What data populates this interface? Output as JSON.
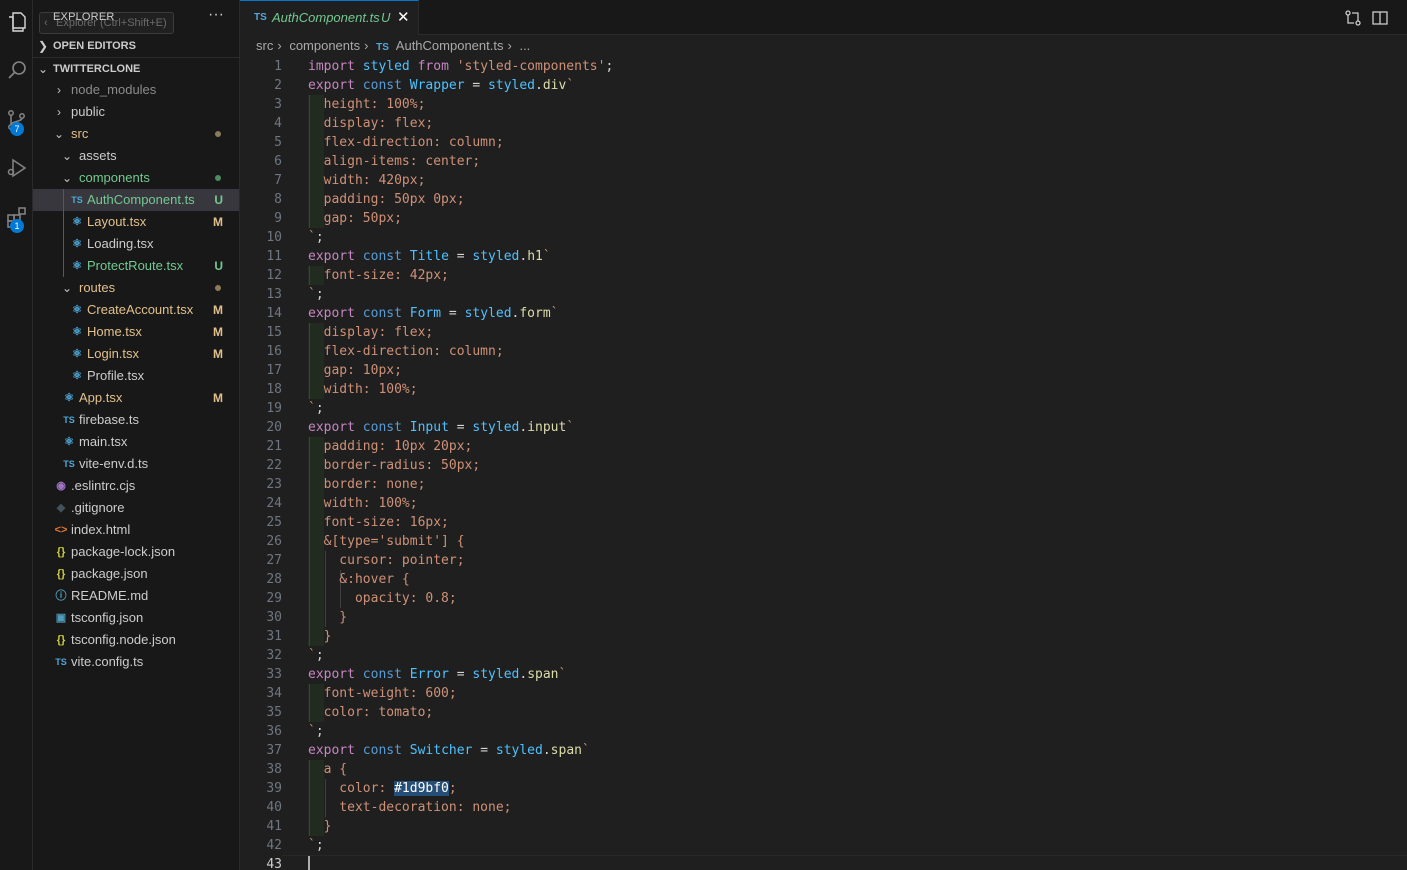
{
  "explorer": {
    "title": "EXPLORER",
    "tooltip": "Explorer (Ctrl+Shift+E)",
    "more": "···",
    "open_editors": "OPEN EDITORS",
    "project": "TWITTERCLONE"
  },
  "activity": {
    "scm_badge": "7",
    "ext_badge": "1"
  },
  "tree": [
    {
      "name": "node_modules",
      "depth": 1,
      "folder": true,
      "open": false,
      "color": "#8b8b8b"
    },
    {
      "name": "public",
      "depth": 1,
      "folder": true,
      "open": false,
      "color": "#cccccc"
    },
    {
      "name": "src",
      "depth": 1,
      "folder": true,
      "open": true,
      "color": "#e2c08d",
      "dot": "#8c7a5c"
    },
    {
      "name": "assets",
      "depth": 2,
      "folder": true,
      "open": true,
      "color": "#cccccc"
    },
    {
      "name": "components",
      "depth": 2,
      "folder": true,
      "open": true,
      "color": "#73c991",
      "dot": "#4e8b63"
    },
    {
      "name": "AuthComponent.ts",
      "depth": 3,
      "icon": "TS",
      "iconColor": "#4fa8d8",
      "color": "#73c991",
      "status": "U",
      "statusColor": "#73c991",
      "selected": true
    },
    {
      "name": "Layout.tsx",
      "depth": 3,
      "icon": "react",
      "iconColor": "#4fa8d8",
      "color": "#e2c08d",
      "status": "M",
      "statusColor": "#e2c08d"
    },
    {
      "name": "Loading.tsx",
      "depth": 3,
      "icon": "react",
      "iconColor": "#4fa8d8",
      "color": "#cccccc"
    },
    {
      "name": "ProtectRoute.tsx",
      "depth": 3,
      "icon": "react",
      "iconColor": "#4fa8d8",
      "color": "#73c991",
      "status": "U",
      "statusColor": "#73c991"
    },
    {
      "name": "routes",
      "depth": 2,
      "folder": true,
      "open": true,
      "color": "#e2c08d",
      "dot": "#8c7a5c"
    },
    {
      "name": "CreateAccount.tsx",
      "depth": 3,
      "icon": "react",
      "iconColor": "#4fa8d8",
      "color": "#e2c08d",
      "status": "M",
      "statusColor": "#e2c08d"
    },
    {
      "name": "Home.tsx",
      "depth": 3,
      "icon": "react",
      "iconColor": "#4fa8d8",
      "color": "#e2c08d",
      "status": "M",
      "statusColor": "#e2c08d"
    },
    {
      "name": "Login.tsx",
      "depth": 3,
      "icon": "react",
      "iconColor": "#4fa8d8",
      "color": "#e2c08d",
      "status": "M",
      "statusColor": "#e2c08d"
    },
    {
      "name": "Profile.tsx",
      "depth": 3,
      "icon": "react",
      "iconColor": "#4fa8d8",
      "color": "#cccccc"
    },
    {
      "name": "App.tsx",
      "depth": 2,
      "icon": "react",
      "iconColor": "#4fa8d8",
      "color": "#e2c08d",
      "status": "M",
      "statusColor": "#e2c08d"
    },
    {
      "name": "firebase.ts",
      "depth": 2,
      "icon": "TS",
      "iconColor": "#4fa8d8",
      "color": "#cccccc"
    },
    {
      "name": "main.tsx",
      "depth": 2,
      "icon": "react",
      "iconColor": "#4fa8d8",
      "color": "#cccccc"
    },
    {
      "name": "vite-env.d.ts",
      "depth": 2,
      "icon": "TS",
      "iconColor": "#4fa8d8",
      "color": "#cccccc"
    },
    {
      "name": ".eslintrc.cjs",
      "depth": 1,
      "icon": "eslint",
      "iconColor": "#a074c4",
      "color": "#cccccc"
    },
    {
      "name": ".gitignore",
      "depth": 1,
      "icon": "git",
      "iconColor": "#41535b",
      "color": "#cccccc"
    },
    {
      "name": "index.html",
      "depth": 1,
      "icon": "html",
      "iconColor": "#e37933",
      "color": "#cccccc"
    },
    {
      "name": "package-lock.json",
      "depth": 1,
      "icon": "json",
      "iconColor": "#cbcb41",
      "color": "#cccccc"
    },
    {
      "name": "package.json",
      "depth": 1,
      "icon": "json",
      "iconColor": "#cbcb41",
      "color": "#cccccc"
    },
    {
      "name": "README.md",
      "depth": 1,
      "icon": "info",
      "iconColor": "#519aba",
      "color": "#cccccc"
    },
    {
      "name": "tsconfig.json",
      "depth": 1,
      "icon": "tsconfig",
      "iconColor": "#519aba",
      "color": "#cccccc"
    },
    {
      "name": "tsconfig.node.json",
      "depth": 1,
      "icon": "json",
      "iconColor": "#cbcb41",
      "color": "#cccccc"
    },
    {
      "name": "vite.config.ts",
      "depth": 1,
      "icon": "TS",
      "iconColor": "#4fa8d8",
      "color": "#cccccc"
    }
  ],
  "tab": {
    "icon": "TS",
    "name": "AuthComponent.ts",
    "status": "U",
    "close": "✕"
  },
  "breadcrumb": [
    "src",
    "components",
    "AuthComponent.ts",
    "..."
  ],
  "current_line": 43,
  "code": [
    [
      [
        "ki",
        "import"
      ],
      [
        "v",
        " styled"
      ],
      [
        "ki",
        " from"
      ],
      [
        "s",
        " 'styled-components'"
      ],
      [
        "p",
        ";"
      ]
    ],
    [
      [
        "ki",
        "export"
      ],
      [
        "k",
        " const"
      ],
      [
        "v",
        " Wrapper"
      ],
      [
        "p",
        " = "
      ],
      [
        "v",
        "styled"
      ],
      [
        "p",
        "."
      ],
      [
        "m",
        "div"
      ],
      [
        "s",
        "`"
      ]
    ],
    [
      [
        "s",
        "  height: 100%;"
      ]
    ],
    [
      [
        "s",
        "  display: flex;"
      ]
    ],
    [
      [
        "s",
        "  flex-direction: column;"
      ]
    ],
    [
      [
        "s",
        "  align-items: center;"
      ]
    ],
    [
      [
        "s",
        "  width: 420px;"
      ]
    ],
    [
      [
        "s",
        "  padding: 50px 0px;"
      ]
    ],
    [
      [
        "s",
        "  gap: 50px;"
      ]
    ],
    [
      [
        "s",
        "`"
      ],
      [
        "p",
        ";"
      ]
    ],
    [
      [
        "ki",
        "export"
      ],
      [
        "k",
        " const"
      ],
      [
        "v",
        " Title"
      ],
      [
        "p",
        " = "
      ],
      [
        "v",
        "styled"
      ],
      [
        "p",
        "."
      ],
      [
        "m",
        "h1"
      ],
      [
        "s",
        "`"
      ]
    ],
    [
      [
        "s",
        "  font-size: 42px;"
      ]
    ],
    [
      [
        "s",
        "`"
      ],
      [
        "p",
        ";"
      ]
    ],
    [
      [
        "ki",
        "export"
      ],
      [
        "k",
        " const"
      ],
      [
        "v",
        " Form"
      ],
      [
        "p",
        " = "
      ],
      [
        "v",
        "styled"
      ],
      [
        "p",
        "."
      ],
      [
        "m",
        "form"
      ],
      [
        "s",
        "`"
      ]
    ],
    [
      [
        "s",
        "  display: flex;"
      ]
    ],
    [
      [
        "s",
        "  flex-direction: column;"
      ]
    ],
    [
      [
        "s",
        "  gap: 10px;"
      ]
    ],
    [
      [
        "s",
        "  width: 100%;"
      ]
    ],
    [
      [
        "s",
        "`"
      ],
      [
        "p",
        ";"
      ]
    ],
    [
      [
        "ki",
        "export"
      ],
      [
        "k",
        " const"
      ],
      [
        "v",
        " Input"
      ],
      [
        "p",
        " = "
      ],
      [
        "v",
        "styled"
      ],
      [
        "p",
        "."
      ],
      [
        "m",
        "input"
      ],
      [
        "s",
        "`"
      ]
    ],
    [
      [
        "s",
        "  padding: 10px 20px;"
      ]
    ],
    [
      [
        "s",
        "  border-radius: 50px;"
      ]
    ],
    [
      [
        "s",
        "  border: none;"
      ]
    ],
    [
      [
        "s",
        "  width: 100%;"
      ]
    ],
    [
      [
        "s",
        "  font-size: 16px;"
      ]
    ],
    [
      [
        "s",
        "  &[type='submit'] {"
      ]
    ],
    [
      [
        "s",
        "    cursor: pointer;"
      ]
    ],
    [
      [
        "s",
        "    &:hover {"
      ]
    ],
    [
      [
        "s",
        "      opacity: 0.8;"
      ]
    ],
    [
      [
        "s",
        "    }"
      ]
    ],
    [
      [
        "s",
        "  }"
      ]
    ],
    [
      [
        "s",
        "`"
      ],
      [
        "p",
        ";"
      ]
    ],
    [
      [
        "ki",
        "export"
      ],
      [
        "k",
        " const"
      ],
      [
        "v",
        " Error"
      ],
      [
        "p",
        " = "
      ],
      [
        "v",
        "styled"
      ],
      [
        "p",
        "."
      ],
      [
        "m",
        "span"
      ],
      [
        "s",
        "`"
      ]
    ],
    [
      [
        "s",
        "  font-weight: 600;"
      ]
    ],
    [
      [
        "s",
        "  color: tomato;"
      ]
    ],
    [
      [
        "s",
        "`"
      ],
      [
        "p",
        ";"
      ]
    ],
    [
      [
        "ki",
        "export"
      ],
      [
        "k",
        " const"
      ],
      [
        "v",
        " Switcher"
      ],
      [
        "p",
        " = "
      ],
      [
        "v",
        "styled"
      ],
      [
        "p",
        "."
      ],
      [
        "m",
        "span"
      ],
      [
        "s",
        "`"
      ]
    ],
    [
      [
        "s",
        "  a {"
      ]
    ],
    [
      [
        "s",
        "    color: "
      ],
      [
        "hl",
        "#1d9bf0"
      ],
      [
        "s",
        ";"
      ]
    ],
    [
      [
        "s",
        "    text-decoration: none;"
      ]
    ],
    [
      [
        "s",
        "  }"
      ]
    ],
    [
      [
        "s",
        "`"
      ],
      [
        "p",
        ";"
      ]
    ],
    [
      [
        "p",
        ""
      ]
    ]
  ]
}
